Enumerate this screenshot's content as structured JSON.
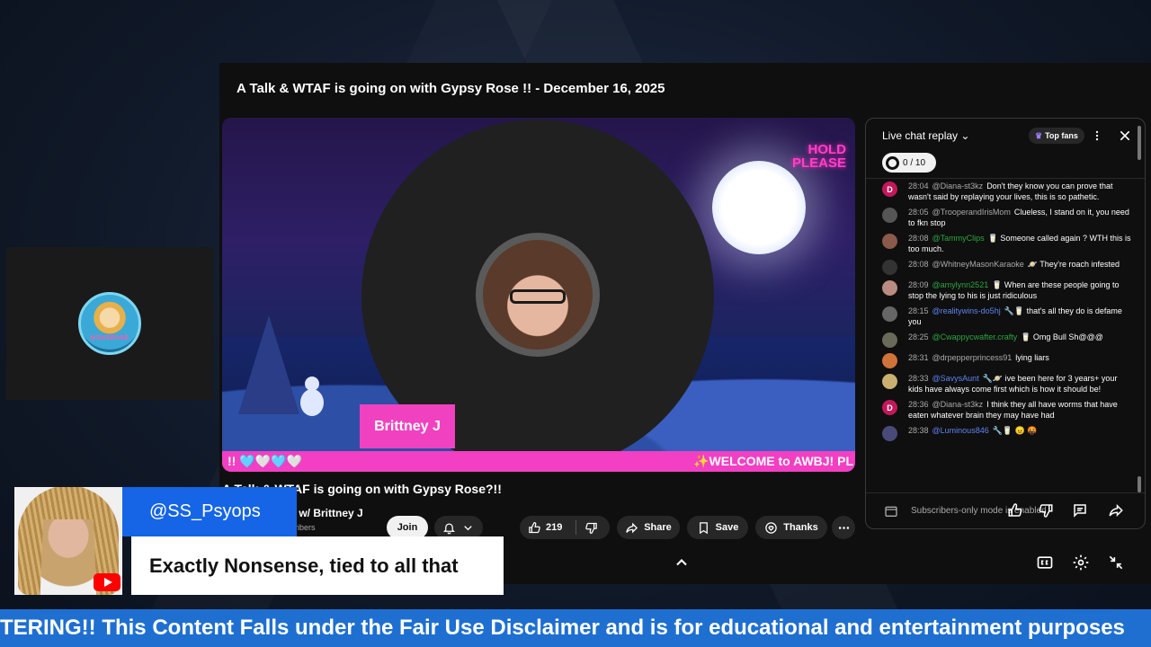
{
  "window": {
    "title": "A Talk & WTAF is going on with Gypsy Rose !! - December 16, 2025"
  },
  "left_tile": {
    "avatar_text": "NONSENSE"
  },
  "video": {
    "hold_line1": "HOLD",
    "hold_line2": "PLEASE",
    "name_tag": "Brittney J",
    "banner_left": "!! 🩵🤍🩵🤍",
    "banner_right": "✨WELCOME to AWBJ! PL"
  },
  "meta": {
    "title": "A Talk & WTAF is going on with Gypsy Rose?!!",
    "channel": "ly w/ Brittney J",
    "subscribers": "scribers",
    "join_label": "Join",
    "likes": "219",
    "share_label": "Share",
    "save_label": "Save",
    "thanks_label": "Thanks"
  },
  "chat": {
    "title": "Live chat replay",
    "top_fans_label": "Top fans",
    "goal": "0 / 10",
    "footer": "Subscribers-only mode is enabled",
    "messages": [
      {
        "time": "28:04",
        "author": "@Diana-st3kz",
        "kind": "normal",
        "avatar": "D",
        "avatar_color": "#c2185b",
        "text": "Don't they know you can prove that wasn't said by replaying your lives, this is so pathetic."
      },
      {
        "time": "28:05",
        "author": "@TrooperandIrisMom",
        "kind": "normal",
        "avatar": "",
        "avatar_color": "#555555",
        "text": "Clueless, I stand on it, you need to fkn stop"
      },
      {
        "time": "28:08",
        "author": "@TammyClips",
        "kind": "member",
        "avatar": "",
        "avatar_color": "#8a5a4a",
        "text": "🥛 Someone called again ? WTH this is too much."
      },
      {
        "time": "28:08",
        "author": "@WhitneyMasonKaraoke",
        "kind": "normal",
        "avatar": "",
        "avatar_color": "#333333",
        "text": "🪐 They're roach infested"
      },
      {
        "time": "28:09",
        "author": "@amylynn2521",
        "kind": "member",
        "avatar": "",
        "avatar_color": "#b88c80",
        "text": "🥛 When are these people going to stop the lying to his is just ridiculous"
      },
      {
        "time": "28:15",
        "author": "@realitywins-do5hj",
        "kind": "mod",
        "avatar": "",
        "avatar_color": "#666666",
        "text": "🔧🥛 that's all they do is defame you"
      },
      {
        "time": "28:25",
        "author": "@Cwappycwafter.crafty",
        "kind": "member",
        "avatar": "",
        "avatar_color": "#6a6a5a",
        "text": "🥛 Omg Bull Sh@@@"
      },
      {
        "time": "28:31",
        "author": "@drpepperprincess91",
        "kind": "normal",
        "avatar": "",
        "avatar_color": "#d0733a",
        "text": "lying liars"
      },
      {
        "time": "28:33",
        "author": "@SavysAunt",
        "kind": "mod",
        "avatar": "",
        "avatar_color": "#c9b070",
        "text": "🔧🪐 ive been here for 3 years+ your kids have always come first which is how it should be!"
      },
      {
        "time": "28:36",
        "author": "@Diana-st3kz",
        "kind": "normal",
        "avatar": "D",
        "avatar_color": "#c2185b",
        "text": "I think they all have worms that have eaten whatever brain they may have had"
      },
      {
        "time": "28:38",
        "author": "@Luminous846",
        "kind": "mod",
        "avatar": "",
        "avatar_color": "#4a4a7a",
        "text": "🔧🥛 😠 🤬"
      }
    ]
  },
  "overlay": {
    "handle": "@SS_Psyops",
    "comment": "Exactly Nonsense, tied to all that"
  },
  "ticker": {
    "text": "TERING!! This Content Falls under the Fair Use Disclaimer and is for educational and entertainment purposes"
  },
  "colors": {
    "accent_pink": "#f23fc3",
    "overlay_blue": "#1565e6",
    "ticker_blue": "#1f6fd1"
  }
}
